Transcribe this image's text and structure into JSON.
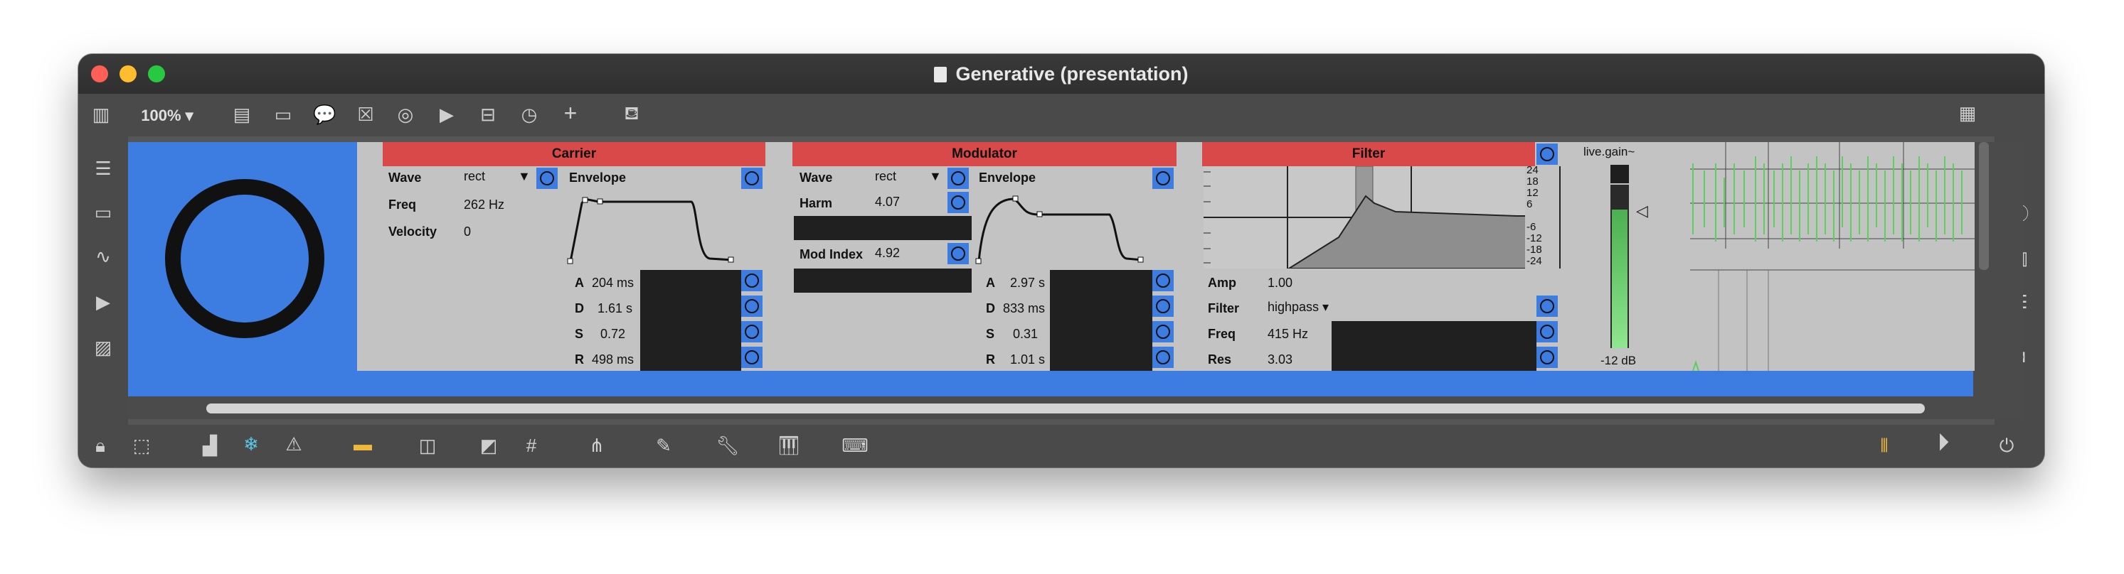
{
  "window": {
    "title": "Generative (presentation)"
  },
  "toolbar": {
    "zoom": "100% ▾",
    "icons": [
      "sidebar-icon",
      "comment-icon",
      "plus-icon",
      "paint-bucket-icon",
      "grid-icon"
    ]
  },
  "carrier": {
    "header": "Carrier",
    "wave_label": "Wave",
    "wave_value": "rect",
    "freq_label": "Freq",
    "freq_value": "262 Hz",
    "velocity_label": "Velocity",
    "velocity_value": "0",
    "env_label": "Envelope",
    "a_label": "A",
    "a_value": "204 ms",
    "d_label": "D",
    "d_value": "1.61 s",
    "s_label": "S",
    "s_value": "0.72",
    "r_label": "R",
    "r_value": "498 ms"
  },
  "modulator": {
    "header": "Modulator",
    "wave_label": "Wave",
    "wave_value": "rect",
    "harm_label": "Harm",
    "harm_value": "4.07",
    "modindex_label": "Mod Index",
    "modindex_value": "4.92",
    "env_label": "Envelope",
    "a_label": "A",
    "a_value": "2.97 s",
    "d_label": "D",
    "d_value": "833 ms",
    "s_label": "S",
    "s_value": "0.31",
    "r_label": "R",
    "r_value": "1.01 s"
  },
  "filter": {
    "header": "Filter",
    "amp_label": "Amp",
    "amp_value": "1.00",
    "type_label": "Filter",
    "type_value": "highpass ▾",
    "freq_label": "Freq",
    "freq_value": "415 Hz",
    "res_label": "Res",
    "res_value": "3.03",
    "scale": [
      "24",
      "18",
      "12",
      "6",
      "-6",
      "-12",
      "-18",
      "-24"
    ]
  },
  "gain": {
    "title": "live.gain~",
    "readout": "-12 dB",
    "level": 0.85
  },
  "colors": {
    "accent": "#3d7de2",
    "header": "#d94949",
    "panel": "#c3c3c3",
    "meter": "#7fe07f"
  }
}
